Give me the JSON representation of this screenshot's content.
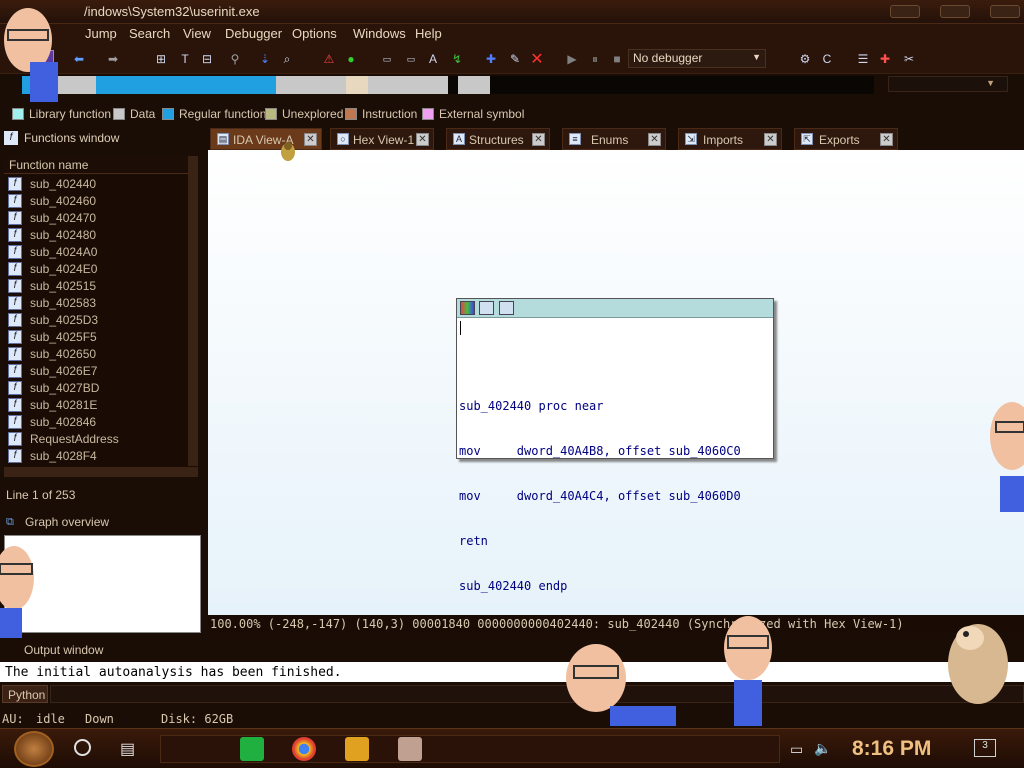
{
  "window": {
    "title": "/indows\\System32\\userinit.exe"
  },
  "menu": [
    "Jump",
    "Search",
    "View",
    "Debugger",
    "Options",
    "Windows",
    "Help"
  ],
  "toolbar": {
    "debugger_label": "No debugger"
  },
  "legend": [
    {
      "label": "Library function",
      "color": "#a0f0f0"
    },
    {
      "label": "Data",
      "color": "#c8c8c8"
    },
    {
      "label": "Regular function",
      "color": "#20a0e0"
    },
    {
      "label": "Unexplored",
      "color": "#b8b880"
    },
    {
      "label": "Instruction",
      "color": "#c07850"
    },
    {
      "label": "External symbol",
      "color": "#f0a0f0"
    }
  ],
  "tabs": [
    {
      "label": "IDA View-A",
      "active": true,
      "icon": "ida-view-icon"
    },
    {
      "label": "Hex View-1",
      "active": false,
      "icon": "hex-view-icon"
    },
    {
      "label": "Structures",
      "active": false,
      "icon": "structures-icon"
    },
    {
      "label": "Enums",
      "active": false,
      "icon": "enums-icon"
    },
    {
      "label": "Imports",
      "active": false,
      "icon": "imports-icon"
    },
    {
      "label": "Exports",
      "active": false,
      "icon": "exports-icon"
    }
  ],
  "functions_panel": {
    "title": "Functions window",
    "column_header": "Function name",
    "items": [
      "sub_402440",
      "sub_402460",
      "sub_402470",
      "sub_402480",
      "sub_4024A0",
      "sub_4024E0",
      "sub_402515",
      "sub_402583",
      "sub_4025D3",
      "sub_4025F5",
      "sub_402650",
      "sub_4026E7",
      "sub_4027BD",
      "sub_40281E",
      "sub_402846",
      "RequestAddress",
      "sub_4028F4"
    ],
    "line_status": "Line 1 of 253"
  },
  "graph_overview": {
    "title": "Graph overview"
  },
  "code_node": {
    "lines": [
      "sub_402440 proc near",
      "mov     dword_40A4B8, offset sub_4060C0",
      "mov     dword_40A4C4, offset sub_4060D0",
      "retn",
      "sub_402440 endp"
    ]
  },
  "graph_status": "100.00% (-248,-147) (140,3) 00001840 0000000000402440: sub_402440 (Synchronized with Hex View-1)",
  "output": {
    "title": "Output window",
    "text": "The initial autoanalysis has been finished.",
    "python_label": "Python"
  },
  "status_bar": {
    "au": "AU:",
    "state": "idle",
    "direction": "Down",
    "disk": "Disk: 62GB"
  },
  "taskbar": {
    "clock": "8:16 PM",
    "notification_count": "3"
  }
}
